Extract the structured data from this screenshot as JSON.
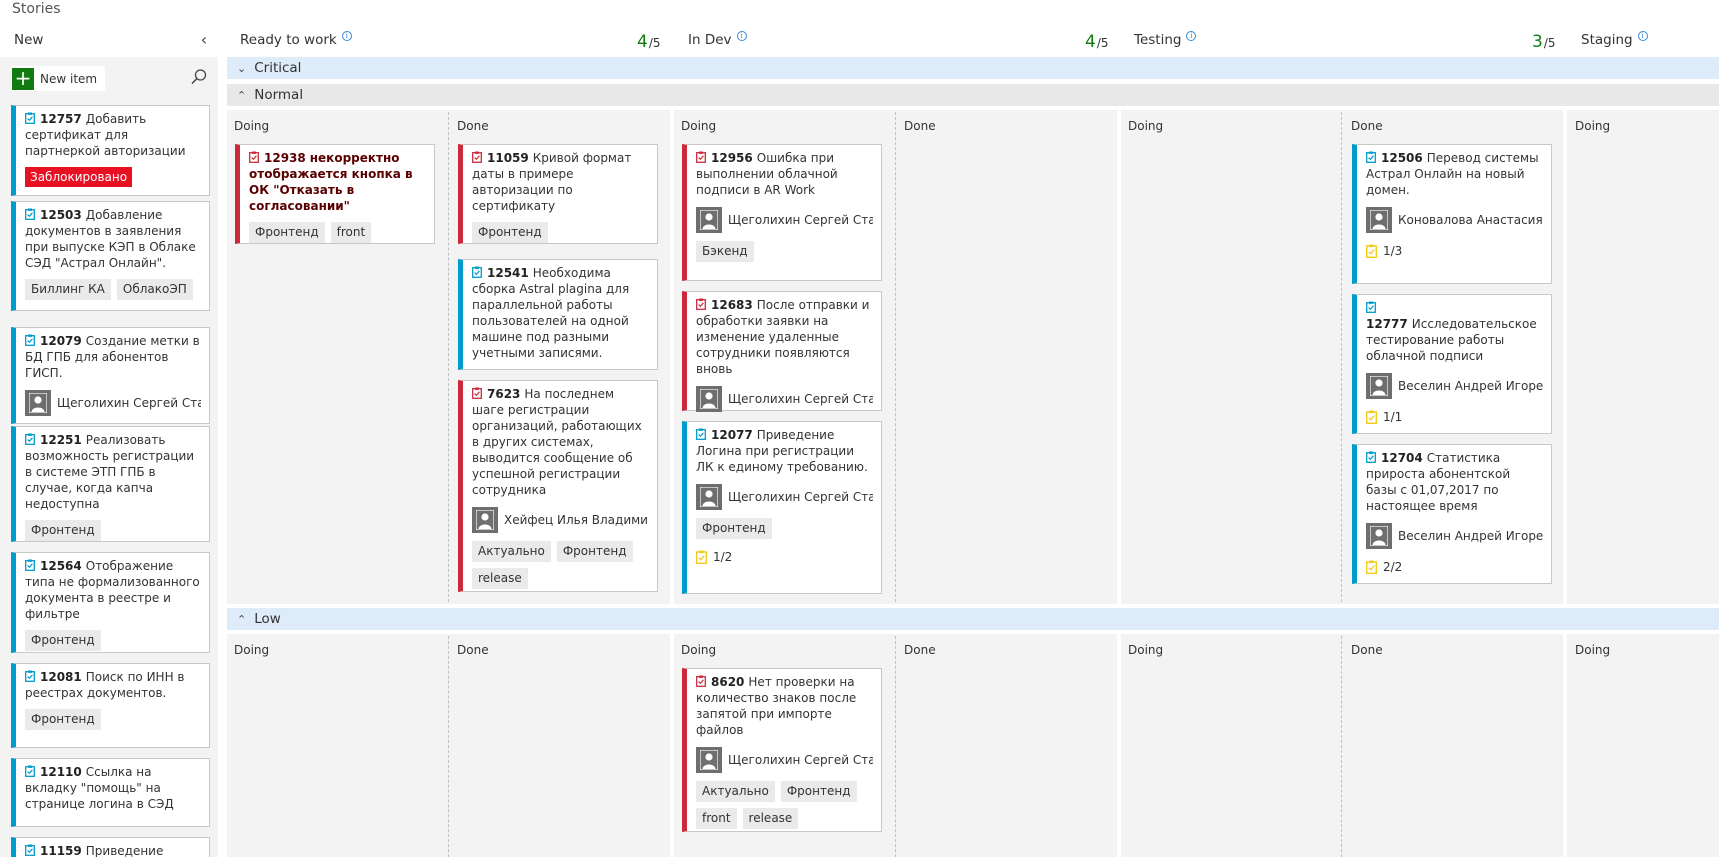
{
  "title": "Stories",
  "columns": {
    "new": {
      "label": "New"
    },
    "ready": {
      "label": "Ready to work",
      "count": "4",
      "limit": "/5"
    },
    "indev": {
      "label": "In Dev",
      "count": "4",
      "limit": "/5"
    },
    "testing": {
      "label": "Testing",
      "count": "3",
      "limit": "/5"
    },
    "staging": {
      "label": "Staging"
    }
  },
  "sub": {
    "doing": "Doing",
    "done": "Done"
  },
  "new_item": "New item",
  "lanes": {
    "critical": "Critical",
    "normal": "Normal",
    "low": "Low"
  },
  "backlog": [
    {
      "id": "12757",
      "title": "Добавить сертификат для партнеркой авторизации",
      "blocked": "Заблокировано"
    },
    {
      "id": "12503",
      "title": "Добавление документов в заявления при выпуске КЭП в Облаке СЭД \"Астрал Онлайн\".",
      "tags": [
        "Биллинг КА",
        "ОблакоЭП"
      ]
    },
    {
      "id": "12079",
      "title": "Создание метки в БД ГПБ для абонентов ГИСП.",
      "assignee": "Щеголихин Сергей Стан..."
    },
    {
      "id": "12251",
      "title": "Реализовать возможность регистрации в системе ЭТП ГПБ в случае, когда капча недоступна",
      "tags": [
        "Фронтенд"
      ]
    },
    {
      "id": "12564",
      "title": "Отображение типа не формализованного документа в реестре и фильтре",
      "tags": [
        "Фронтенд"
      ]
    },
    {
      "id": "12081",
      "title": "Поиск  по ИНН в реестрах документов.",
      "tags": [
        "Фронтенд"
      ]
    },
    {
      "id": "12110",
      "title": "Ссылка на вкладку \"помощь\" на странице логина в СЭД"
    },
    {
      "id": "11159",
      "title": "Приведение названия"
    }
  ],
  "cards": {
    "c12938": {
      "id": "12938",
      "title": "некорректно отображается кнопка в ОК \"Отказать в согласовании\"",
      "tags": [
        "Фронтенд",
        "front"
      ]
    },
    "c11059": {
      "id": "11059",
      "title": "Кривой формат даты в примере авторизации по сертификату",
      "tags": [
        "Фронтенд"
      ]
    },
    "c12541": {
      "id": "12541",
      "title": "Необходима сборка Astral plagina для параллельной работы пользователей на одной машине под разными учетными записями."
    },
    "c7623": {
      "id": "7623",
      "title": "На последнем шаге регистрации организаций, работающих в других системах, выводится сообщение об успешной регистрации сотрудника",
      "assignee": "Хейфец Илья Владимир...",
      "tags": [
        "Актуально",
        "Фронтенд",
        "release"
      ]
    },
    "c12956": {
      "id": "12956",
      "title": "Ошибка при выполнении облачной подписи в AR Work",
      "assignee": "Щеголихин Сергей Стан...",
      "tags": [
        "Бэкенд"
      ]
    },
    "c12683": {
      "id": "12683",
      "title": "После отправки и обработки заявки на изменение удаленные сотрудники появляются вновь",
      "assignee": "Щеголихин Сергей Стан..."
    },
    "c12077": {
      "id": "12077",
      "title": "Приведение Логина при регистрации ЛК к единому требованию.",
      "assignee": "Щеголихин Сергей Стан...",
      "tags": [
        "Фронтенд"
      ],
      "tasks": "1/2"
    },
    "c12506": {
      "id": "12506",
      "title": "Перевод системы Астрал Онлайн на новый домен.",
      "assignee": "Коновалова Анастасия ...",
      "tasks": "1/3"
    },
    "c12777": {
      "id": "12777",
      "title": "Исследовательское тестирование работы облачной подписи",
      "assignee": "Веселин Андрей Игоре...",
      "tasks": "1/1"
    },
    "c12704": {
      "id": "12704",
      "title": "Статистика прироста абонентской базы с 01,07,2017 по настоящее время",
      "assignee": "Веселин Андрей Игоре...",
      "tasks": "2/2"
    },
    "c8620": {
      "id": "8620",
      "title": "Нет проверки на количество знаков после запятой при импорте файлов",
      "assignee": "Щеголихин Сергей Стан...",
      "tags": [
        "Актуально",
        "Фронтенд",
        "front",
        "release"
      ]
    }
  },
  "colors": {
    "accent": "#107c10",
    "story": "#009ccc",
    "bug": "#cc293d",
    "blocked": "#e81123",
    "lane_header": "#deecf9"
  }
}
